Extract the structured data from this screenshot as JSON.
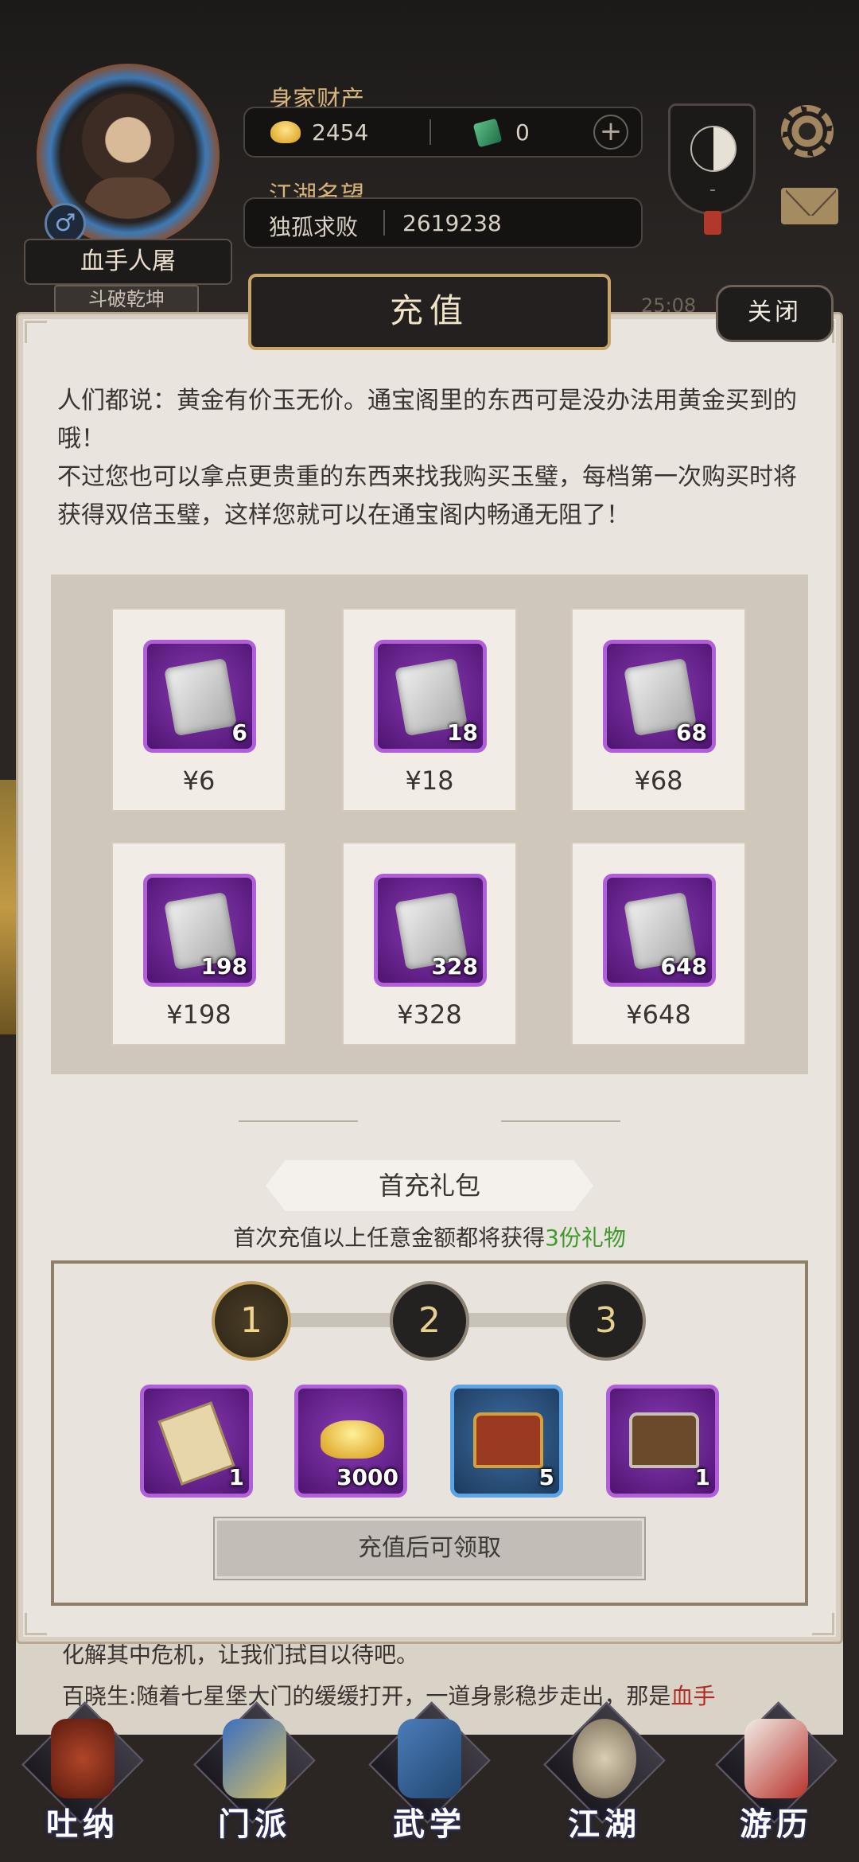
{
  "header": {
    "character_name": "血手人屠",
    "character_title": "斗破乾坤",
    "wealth_label": "身家财产",
    "gold_amount": "2454",
    "jade_amount": "0",
    "plus_label": "+",
    "reputation_label": "江湖名望",
    "reputation_rank": "独孤求败",
    "reputation_value": "2619238",
    "gender_symbol": "♂",
    "emblem_dash": "-",
    "event_text": "25:08"
  },
  "modal": {
    "title": "充值",
    "close_label": "关闭",
    "intro_line1": "人们都说：黄金有价玉无价。通宝阁里的东西可是没办法用黄金买到的哦！",
    "intro_line2": "不过您也可以拿点更贵重的东西来找我购买玉璧，每档第一次购买时将获得双倍玉璧，这样您就可以在通宝阁内畅通无阻了！",
    "packages": [
      {
        "count": "6",
        "price": "¥6"
      },
      {
        "count": "18",
        "price": "¥18"
      },
      {
        "count": "68",
        "price": "¥68"
      },
      {
        "count": "198",
        "price": "¥198"
      },
      {
        "count": "328",
        "price": "¥328"
      },
      {
        "count": "648",
        "price": "¥648"
      }
    ],
    "gift": {
      "title": "首充礼包",
      "subtitle_prefix": "首次充值以上任意金额都将获得",
      "subtitle_highlight": "3份礼物",
      "steps": [
        "1",
        "2",
        "3"
      ],
      "active_step": 1,
      "rewards": [
        {
          "icon": "scroll-book-icon",
          "count": "1"
        },
        {
          "icon": "gold-ingot-icon",
          "count": "3000"
        },
        {
          "icon": "red-chest-icon",
          "count": "5"
        },
        {
          "icon": "wooden-chest-icon",
          "count": "1"
        }
      ],
      "claim_label": "充值后可领取"
    }
  },
  "story": {
    "line1": "化解其中危机，让我们拭目以待吧。",
    "line2": "百晓生:随着七星堡大门的缓缓打开，一道身影稳步走出，那是",
    "line2_red": "血手"
  },
  "nav": {
    "items": [
      {
        "label": "吐纳",
        "icon": "meditation-icon"
      },
      {
        "label": "门派",
        "icon": "sect-icon"
      },
      {
        "label": "武学",
        "icon": "martial-arts-icon"
      },
      {
        "label": "江湖",
        "icon": "jianghu-icon"
      },
      {
        "label": "游历",
        "icon": "travel-icon"
      }
    ]
  },
  "colors": {
    "accent_gold": "#c9a46a",
    "item_purple": "#8a3bb5",
    "item_blue": "#3b6fa3",
    "highlight_green": "#3f9a2e",
    "story_red": "#b02b22"
  }
}
